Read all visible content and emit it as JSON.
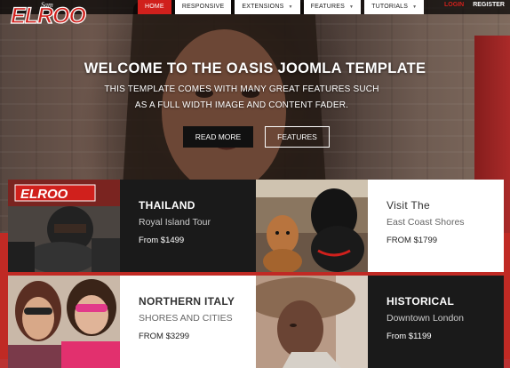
{
  "nav": {
    "logo_text": "ELROO",
    "logo_small": "Sam",
    "items": [
      {
        "label": "HOME",
        "active": true,
        "dropdown": false
      },
      {
        "label": "RESPONSIVE",
        "active": false,
        "dropdown": false
      },
      {
        "label": "EXTENSIONS",
        "active": false,
        "dropdown": true
      },
      {
        "label": "FEATURES",
        "active": false,
        "dropdown": true
      },
      {
        "label": "TUTORIALS",
        "active": false,
        "dropdown": true
      }
    ],
    "login": "LOGIN",
    "register": "REGISTER"
  },
  "hero": {
    "title": "WELCOME TO THE OASIS JOOMLA TEMPLATE",
    "subtitle_line1": "THIS TEMPLATE COMES WITH MANY GREAT FEATURES SUCH",
    "subtitle_line2": "AS A FULL WIDTH IMAGE AND CONTENT FADER.",
    "read_more": "READ MORE",
    "features": "FEATURES"
  },
  "cards": [
    {
      "title": "THAILAND",
      "subtitle": "Royal Island Tour",
      "price": "From $1499",
      "style": "dark",
      "image": "racing-kid"
    },
    {
      "title": "Visit The",
      "subtitle": "East Coast Shores",
      "price": "FROM $1799",
      "style": "light",
      "image": "dogs"
    },
    {
      "title": "NORTHERN ITALY",
      "subtitle": "SHORES AND CITIES",
      "price": "FROM $3299",
      "style": "light",
      "image": "women-sunglasses"
    },
    {
      "title": "HISTORICAL",
      "subtitle": "Downtown London",
      "price": "From $1199",
      "style": "dark",
      "image": "woman-hat"
    }
  ],
  "colors": {
    "accent": "#d0201c",
    "dark_panel": "#1a1a1a"
  }
}
